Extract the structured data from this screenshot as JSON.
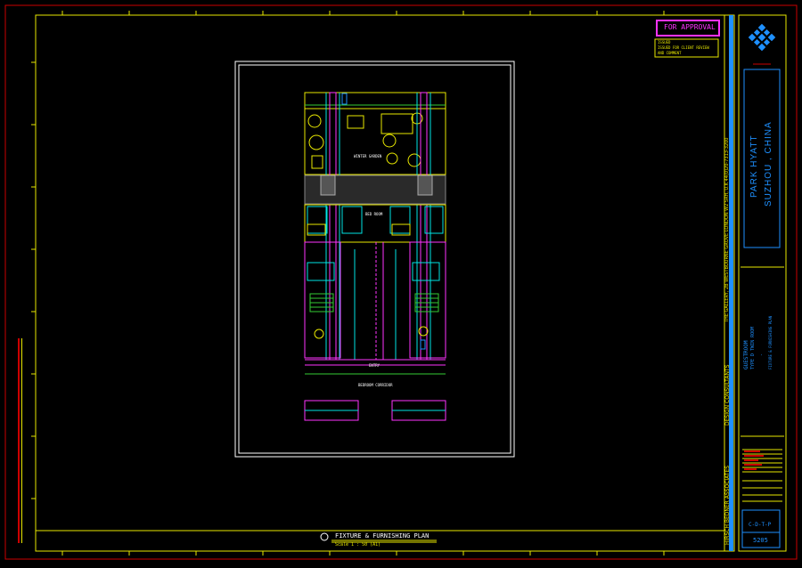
{
  "approval": {
    "label": "FOR APPROVAL",
    "note_head": "ISSUED",
    "note_line1": "ISSUED FOR CLIENT REVIEW",
    "note_line2": "AND COMMENT"
  },
  "project": {
    "name_line1": "PARK HYATT",
    "name_line2": "SUZHOU , CHINA"
  },
  "consultant": {
    "firm": "HIRSCH BEDNER ASSOCIATES",
    "role": "DESIGN CONSULTANTS",
    "address": "THE GALLERY, 2B WESTBOURNE GROVE  LONDON W2 5RH, U.K  44(0)20-7313-3200"
  },
  "drawing": {
    "category": "GUESTROOM",
    "type": "TYPE D TWIN ROOM",
    "dash": "-",
    "subject": "FIXTURE & FURNISHING PLAN",
    "title": "FIXTURE & FURNISHING PLAN",
    "scale": "Scale 1 : 50 (A1)",
    "code": "C-D-T-P",
    "number": "5205"
  },
  "plan_labels": {
    "room": "WINTER GARDEN",
    "bed": "BED ROOM",
    "corridor": "BEDROOM CORRIDOR",
    "entry": "ENTRY"
  },
  "colors": {
    "border_red": "#cc0000",
    "frame_yellow": "#e8e800",
    "accent_blue": "#1e90ff",
    "wall_magenta": "#ff33ff",
    "green": "#33cc33",
    "cyan": "#00e5e5"
  }
}
